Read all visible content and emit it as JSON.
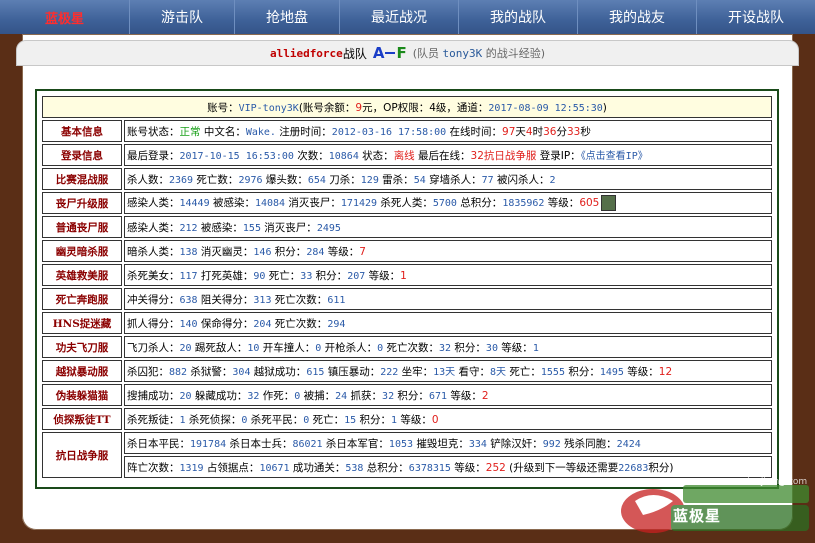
{
  "nav": {
    "brand": "蓝极星",
    "items": [
      "游击队",
      "抢地盘",
      "最近战况",
      "我的战队",
      "我的战友",
      "开设战队"
    ]
  },
  "title": {
    "team_name": "alliedforce",
    "team_suffix": "战队",
    "subtitle_prefix": "(队员",
    "member": "tony3K",
    "subtitle_suffix": "的战斗经验)"
  },
  "account": {
    "label": "账号：",
    "id": "VIP-tony3K",
    "balance_label": "(账号余额：",
    "balance": "9",
    "op_label": "元，OP权限：",
    "op_level": "4级",
    "time_label": "，通道：",
    "time": "2017-08-09 12:55:30",
    "close": ")"
  },
  "rows": [
    {
      "label": "基本信息",
      "segments": [
        {
          "t": "账号状态："
        },
        {
          "t": "正常",
          "c": "g"
        },
        {
          "t": " 中文名："
        },
        {
          "t": "Wake.",
          "c": "v"
        },
        {
          "t": " 注册时间："
        },
        {
          "t": "2012-03-16 17:58:00",
          "c": "v"
        },
        {
          "t": " 在线时间："
        },
        {
          "t": "97",
          "c": "r"
        },
        {
          "t": "天"
        },
        {
          "t": "4",
          "c": "r"
        },
        {
          "t": "时"
        },
        {
          "t": "36",
          "c": "r"
        },
        {
          "t": "分"
        },
        {
          "t": "33",
          "c": "r"
        },
        {
          "t": "秒"
        }
      ]
    },
    {
      "label": "登录信息",
      "segments": [
        {
          "t": "最后登录："
        },
        {
          "t": "2017-10-15 16:53:00",
          "c": "v"
        },
        {
          "t": " 次数："
        },
        {
          "t": "10864",
          "c": "v"
        },
        {
          "t": " 状态："
        },
        {
          "t": "离线",
          "c": "r"
        },
        {
          "t": " 最后在线："
        },
        {
          "t": "32",
          "c": "r"
        },
        {
          "t": "抗日战争服",
          "c": "r"
        },
        {
          "t": " 登录IP："
        },
        {
          "t": "《点击查看IP》",
          "c": "v"
        }
      ]
    },
    {
      "label": "比赛混战服",
      "segments": [
        {
          "t": "杀人数："
        },
        {
          "t": "2369",
          "c": "v"
        },
        {
          "t": " 死亡数："
        },
        {
          "t": "2976",
          "c": "v"
        },
        {
          "t": " 爆头数："
        },
        {
          "t": "654",
          "c": "v"
        },
        {
          "t": " 刀杀："
        },
        {
          "t": "129",
          "c": "v"
        },
        {
          "t": " 雷杀："
        },
        {
          "t": "54",
          "c": "v"
        },
        {
          "t": " 穿墙杀人："
        },
        {
          "t": "77",
          "c": "v"
        },
        {
          "t": " 被闪杀人："
        },
        {
          "t": "2",
          "c": "v"
        }
      ]
    },
    {
      "label": "丧尸升级服",
      "avatar": true,
      "segments": [
        {
          "t": "感染人类："
        },
        {
          "t": "14449",
          "c": "v"
        },
        {
          "t": " 被感染："
        },
        {
          "t": "14084",
          "c": "v"
        },
        {
          "t": " 消灭丧尸："
        },
        {
          "t": "171429",
          "c": "v"
        },
        {
          "t": " 杀死人类："
        },
        {
          "t": "5700",
          "c": "v"
        },
        {
          "t": " 总积分："
        },
        {
          "t": "1835962",
          "c": "v"
        },
        {
          "t": " 等级："
        },
        {
          "t": "605",
          "c": "r"
        }
      ]
    },
    {
      "label": "普通丧尸服",
      "segments": [
        {
          "t": "感染人类："
        },
        {
          "t": "212",
          "c": "v"
        },
        {
          "t": " 被感染："
        },
        {
          "t": "155",
          "c": "v"
        },
        {
          "t": " 消灭丧尸："
        },
        {
          "t": "2495",
          "c": "v"
        }
      ]
    },
    {
      "label": "幽灵暗杀服",
      "segments": [
        {
          "t": "暗杀人类："
        },
        {
          "t": "138",
          "c": "v"
        },
        {
          "t": " 消灭幽灵："
        },
        {
          "t": "146",
          "c": "v"
        },
        {
          "t": " 积分："
        },
        {
          "t": "284",
          "c": "v"
        },
        {
          "t": " 等级："
        },
        {
          "t": "7",
          "c": "r"
        }
      ]
    },
    {
      "label": "英雄救美服",
      "segments": [
        {
          "t": "杀死美女："
        },
        {
          "t": "117",
          "c": "v"
        },
        {
          "t": " 打死英雄："
        },
        {
          "t": "90",
          "c": "v"
        },
        {
          "t": " 死亡："
        },
        {
          "t": "33",
          "c": "v"
        },
        {
          "t": " 积分："
        },
        {
          "t": "207",
          "c": "v"
        },
        {
          "t": " 等级："
        },
        {
          "t": "1",
          "c": "r"
        }
      ]
    },
    {
      "label": "死亡奔跑服",
      "segments": [
        {
          "t": "冲关得分："
        },
        {
          "t": "638",
          "c": "v"
        },
        {
          "t": " 阻关得分："
        },
        {
          "t": "313",
          "c": "v"
        },
        {
          "t": " 死亡次数："
        },
        {
          "t": "611",
          "c": "v"
        }
      ]
    },
    {
      "label": "HNS捉迷藏",
      "segments": [
        {
          "t": "抓人得分："
        },
        {
          "t": "140",
          "c": "v"
        },
        {
          "t": " 保命得分："
        },
        {
          "t": "204",
          "c": "v"
        },
        {
          "t": " 死亡次数："
        },
        {
          "t": "294",
          "c": "v"
        }
      ]
    },
    {
      "label": "功夫飞刀服",
      "segments": [
        {
          "t": "飞刀杀人："
        },
        {
          "t": "20",
          "c": "v"
        },
        {
          "t": " 踢死敌人："
        },
        {
          "t": "10",
          "c": "v"
        },
        {
          "t": " 开车撞人："
        },
        {
          "t": "0",
          "c": "v"
        },
        {
          "t": " 开枪杀人："
        },
        {
          "t": "0",
          "c": "v"
        },
        {
          "t": " 死亡次数："
        },
        {
          "t": "32",
          "c": "v"
        },
        {
          "t": " 积分："
        },
        {
          "t": "30",
          "c": "v"
        },
        {
          "t": " 等级："
        },
        {
          "t": "1",
          "c": "v"
        }
      ]
    },
    {
      "label": "越狱暴动服",
      "segments": [
        {
          "t": "杀囚犯："
        },
        {
          "t": "882",
          "c": "v"
        },
        {
          "t": " 杀狱警："
        },
        {
          "t": "304",
          "c": "v"
        },
        {
          "t": " 越狱成功："
        },
        {
          "t": "615",
          "c": "v"
        },
        {
          "t": " 镇压暴动："
        },
        {
          "t": "222",
          "c": "v"
        },
        {
          "t": " 坐牢："
        },
        {
          "t": "13天",
          "c": "v"
        },
        {
          "t": " 看守："
        },
        {
          "t": "8天",
          "c": "v"
        },
        {
          "t": " 死亡："
        },
        {
          "t": "1555",
          "c": "v"
        },
        {
          "t": " 积分："
        },
        {
          "t": "1495",
          "c": "v"
        },
        {
          "t": " 等级："
        },
        {
          "t": "12",
          "c": "r"
        }
      ]
    },
    {
      "label": "伪装躲猫猫",
      "segments": [
        {
          "t": "搜捕成功："
        },
        {
          "t": "20",
          "c": "v"
        },
        {
          "t": " 躲藏成功："
        },
        {
          "t": "32",
          "c": "v"
        },
        {
          "t": " 作死："
        },
        {
          "t": "0",
          "c": "v"
        },
        {
          "t": " 被捕："
        },
        {
          "t": "24",
          "c": "v"
        },
        {
          "t": " 抓获："
        },
        {
          "t": "32",
          "c": "v"
        },
        {
          "t": " 积分："
        },
        {
          "t": "671",
          "c": "v"
        },
        {
          "t": " 等级："
        },
        {
          "t": "2",
          "c": "r"
        }
      ]
    },
    {
      "label": "侦探叛徒TT",
      "segments": [
        {
          "t": "杀死叛徒："
        },
        {
          "t": "1",
          "c": "v"
        },
        {
          "t": " 杀死侦探："
        },
        {
          "t": "0",
          "c": "v"
        },
        {
          "t": " 杀死平民："
        },
        {
          "t": "0",
          "c": "v"
        },
        {
          "t": " 死亡："
        },
        {
          "t": "15",
          "c": "v"
        },
        {
          "t": " 积分："
        },
        {
          "t": "1",
          "c": "v"
        },
        {
          "t": " 等级："
        },
        {
          "t": "0",
          "c": "r"
        }
      ]
    }
  ],
  "last": {
    "label": "抗日战争服",
    "line1": [
      {
        "t": "杀日本平民："
      },
      {
        "t": "191784",
        "c": "v"
      },
      {
        "t": " 杀日本士兵："
      },
      {
        "t": "86021",
        "c": "v"
      },
      {
        "t": " 杀日本军官："
      },
      {
        "t": "1053",
        "c": "v"
      },
      {
        "t": " 摧毁坦克："
      },
      {
        "t": "334",
        "c": "v"
      },
      {
        "t": " 铲除汉奸："
      },
      {
        "t": "992",
        "c": "v"
      },
      {
        "t": " 残杀同胞："
      },
      {
        "t": "2424",
        "c": "v"
      }
    ],
    "line2": [
      {
        "t": "阵亡次数："
      },
      {
        "t": "1319",
        "c": "v"
      },
      {
        "t": " 占领据点："
      },
      {
        "t": "10671",
        "c": "v"
      },
      {
        "t": " 成功通关："
      },
      {
        "t": "538",
        "c": "v"
      },
      {
        "t": " 总积分："
      },
      {
        "t": "6378315",
        "c": "v"
      },
      {
        "t": " 等级："
      },
      {
        "t": "252",
        "c": "r"
      },
      {
        "t": " (升级到下一等级还需要"
      },
      {
        "t": "22683",
        "c": "v"
      },
      {
        "t": "积分)"
      }
    ]
  },
  "watermark": {
    "top": "www.lanjixing.com",
    "main": "蓝极星"
  },
  "colors": {
    "nav_bg": "#3e6198",
    "frame_bg": "#5a2e16",
    "label_red": "#8b0000",
    "value_blue": "#2a5aa8",
    "highlight_red": "#e0201c",
    "status_green": "#1aa01a",
    "account_bg": "#fffde0"
  }
}
